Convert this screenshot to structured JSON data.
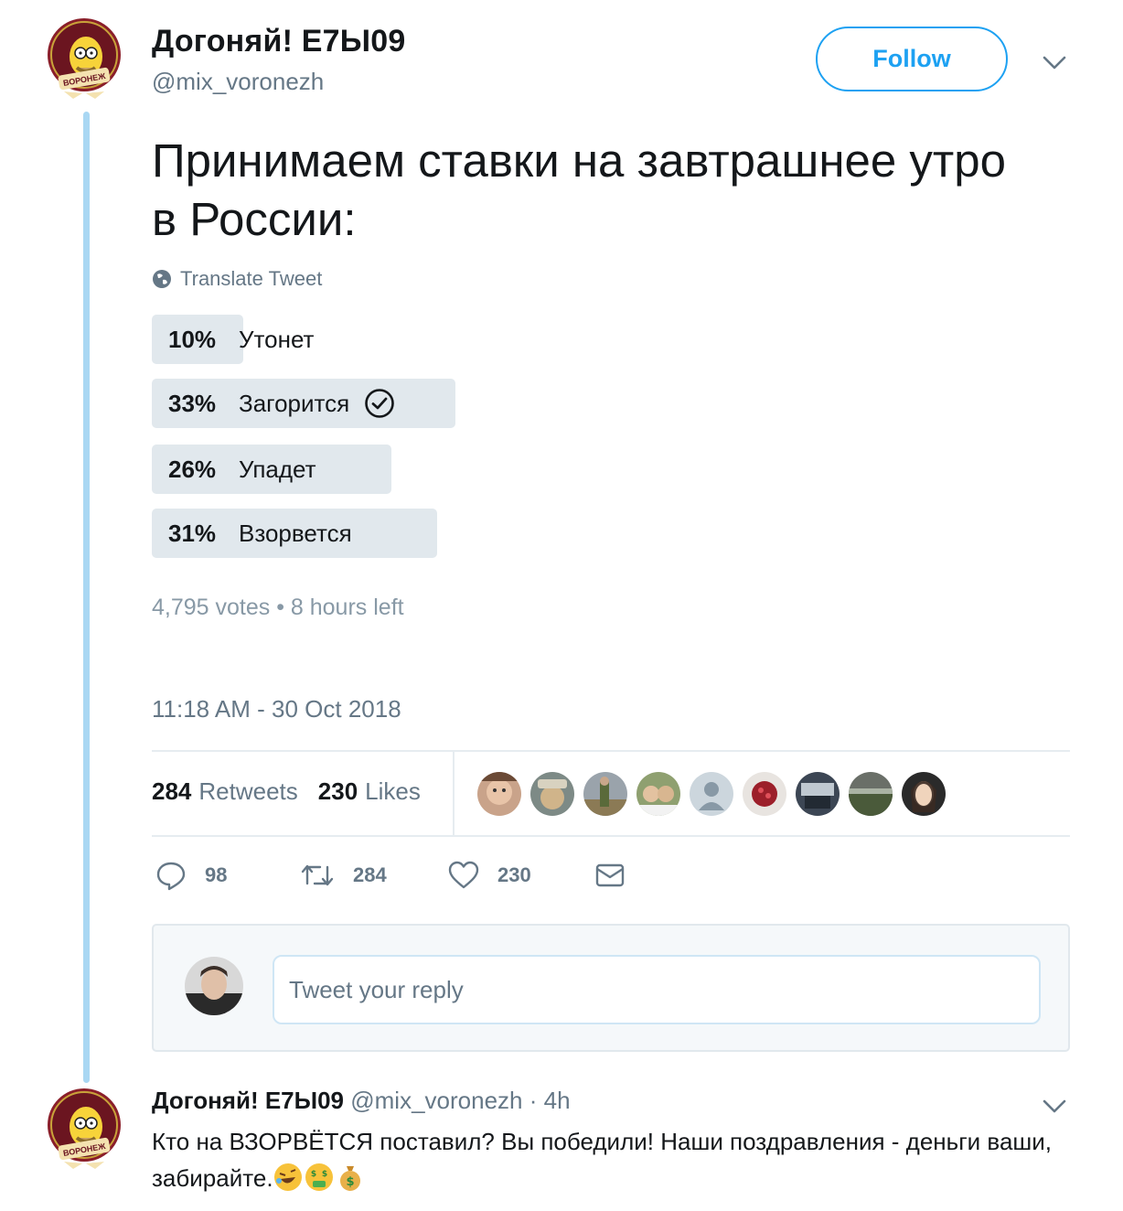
{
  "tweet": {
    "author": {
      "name": "Догоняй! Е7Ы09",
      "handle": "@mix_voronezh",
      "avatar_caption": "ВОРОНЕЖ"
    },
    "follow_label": "Follow",
    "text": "Принимаем ставки на завтрашнее утро в России:",
    "translate_label": "Translate Tweet",
    "poll": {
      "options": [
        {
          "percent": "10%",
          "label": "Утонет",
          "share": 0.1
        },
        {
          "percent": "33%",
          "label": "Загорится",
          "share": 0.33,
          "selected": true
        },
        {
          "percent": "26%",
          "label": "Упадет",
          "share": 0.26
        },
        {
          "percent": "31%",
          "label": "Взорвется",
          "share": 0.31
        }
      ],
      "meta": "4,795 votes • 8 hours left"
    },
    "timestamp": "11:18 AM - 30 Oct 2018",
    "stats": {
      "retweets_count": "284",
      "retweets_label": "Retweets",
      "likes_count": "230",
      "likes_label": "Likes"
    },
    "actions": {
      "reply_count": "98",
      "retweet_count": "284",
      "like_count": "230"
    },
    "reply_box": {
      "placeholder": "Tweet your reply"
    }
  },
  "reply": {
    "name": "Догоняй! Е7Ы09",
    "handle": "@mix_voronezh",
    "time": "· 4h",
    "text": "Кто на ВЗОРВЁТСЯ поставил? Вы победили! Наши поздравления - деньги ваши, забирайте."
  },
  "colors": {
    "accent": "#1da1f2",
    "thread_line": "#a9d7f3",
    "poll_bar": "#e1e8ed",
    "secondary_text": "#657786"
  }
}
